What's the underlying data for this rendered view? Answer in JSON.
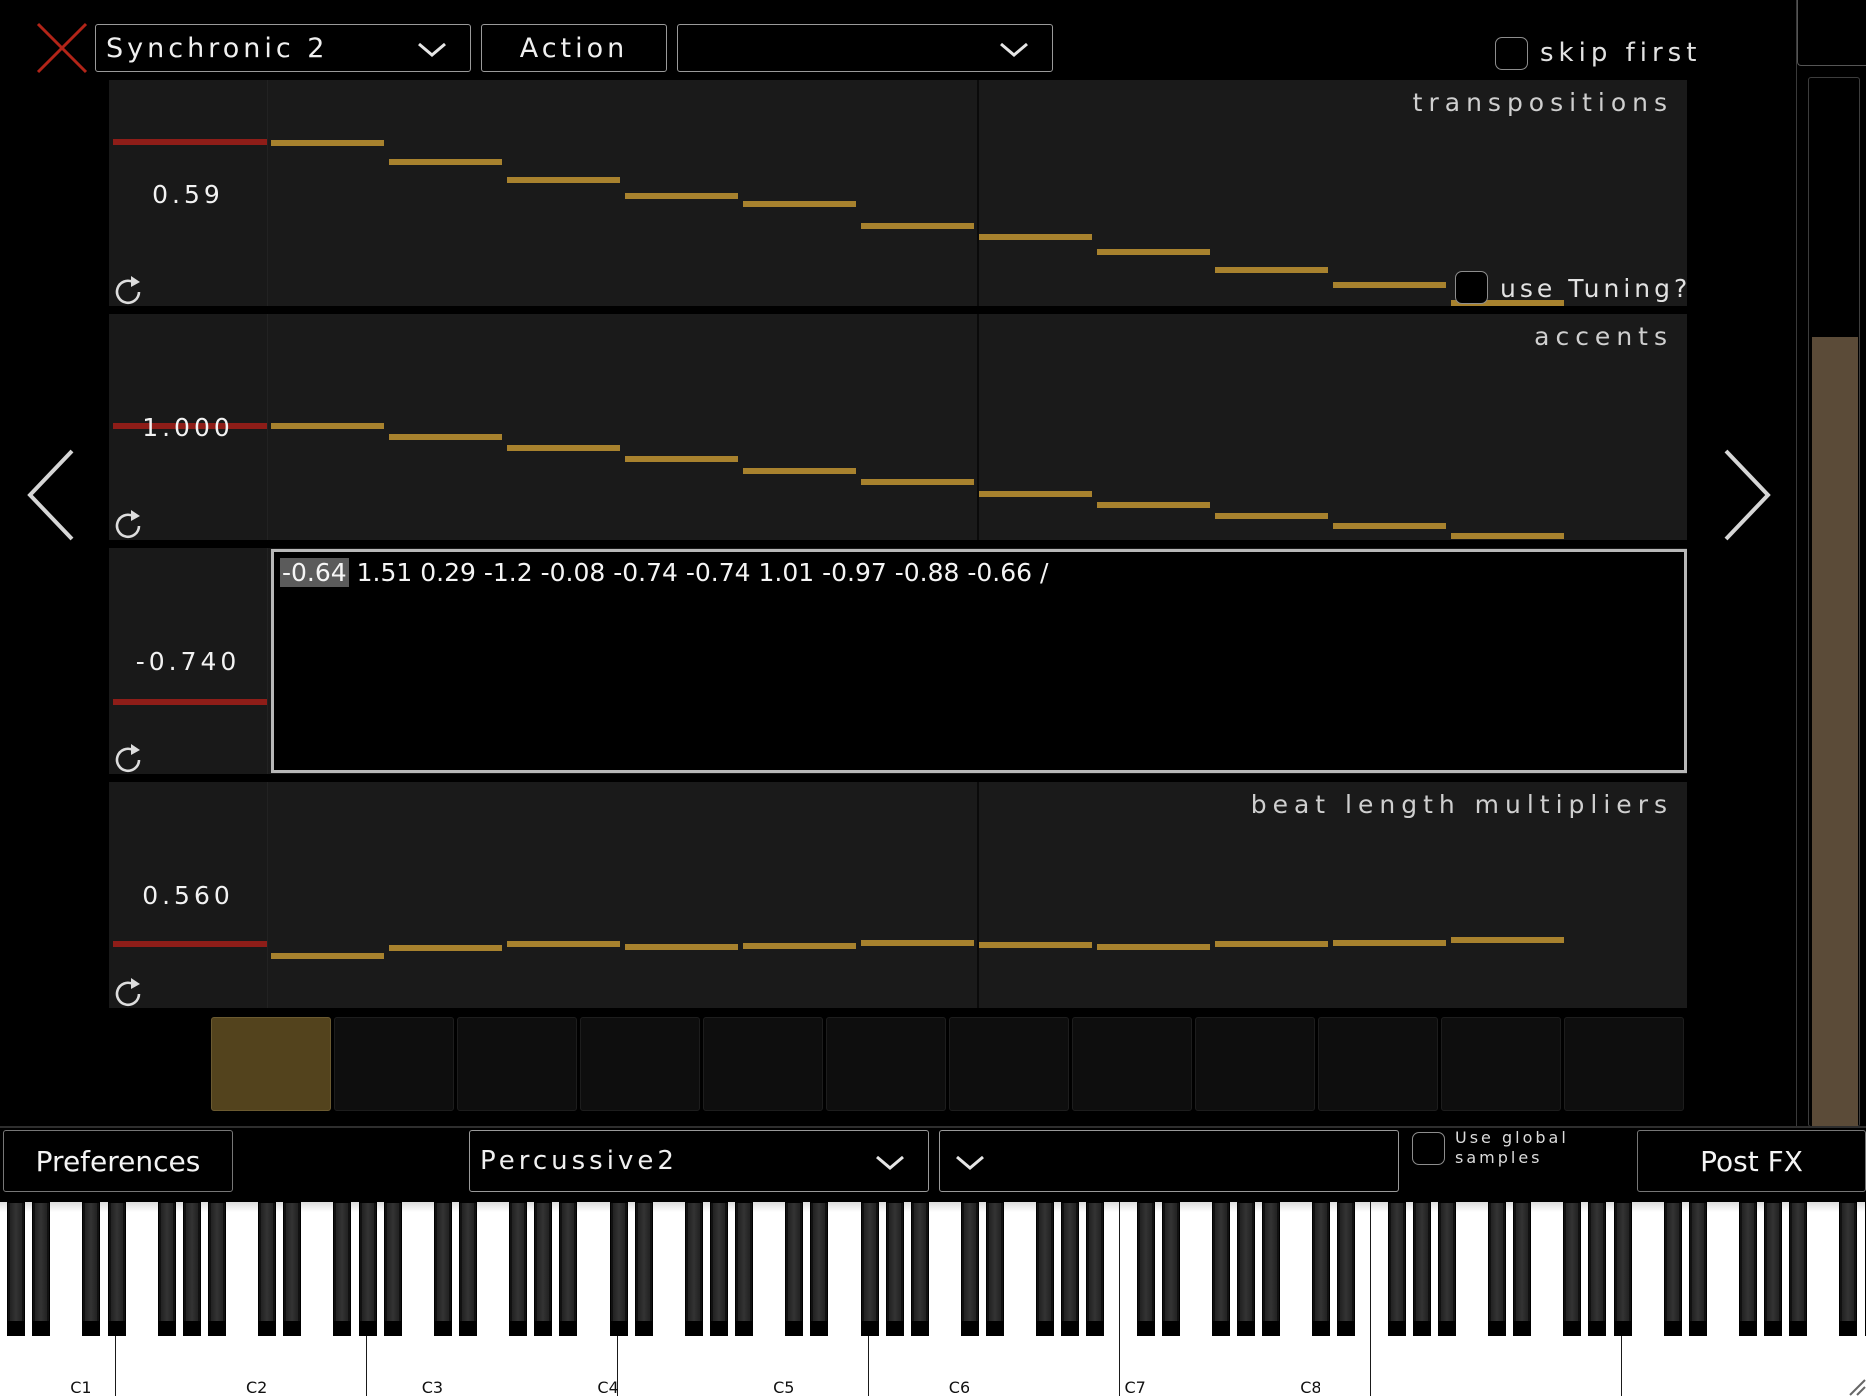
{
  "header": {
    "preparation_select": "Synchronic 2",
    "action_button": "Action",
    "second_select": "",
    "skip_first_label": "skip first"
  },
  "sliders": {
    "transpositions": {
      "title": "transpositions",
      "value": "0.59",
      "use_tuning_label": "use Tuning?"
    },
    "accents": {
      "title": "accents",
      "value": "1.000"
    },
    "sustain_lengths": {
      "value": "-0.740",
      "text_selected": "-0.64",
      "text_rest": " 1.51 0.29 -1.2 -0.08 -0.74 -0.74 1.01 -0.97 -0.88 -0.66 /"
    },
    "beat_length_multipliers": {
      "title": "beat length multipliers",
      "value": "0.560"
    }
  },
  "steps": {
    "count": 12,
    "active_index": 0
  },
  "vertical_scroll": {
    "fraction_visible": 0.75,
    "position": "bottom"
  },
  "footer": {
    "preferences_button": "Preferences",
    "sample_select": "Percussive2",
    "second_select": "",
    "use_global_samples_label_1": "Use global",
    "use_global_samples_label_2": "samples",
    "post_fx_button": "Post FX"
  },
  "piano": {
    "octave_labels": [
      "C1",
      "C2",
      "C3",
      "C4",
      "C5",
      "C6",
      "C7",
      "C8"
    ]
  },
  "colors": {
    "bar_gold": "#a8822e",
    "indicator_red": "#8e1d18",
    "close_red": "#b22418",
    "active_step": "#53431d",
    "scroll_thumb": "#5b4b38"
  }
}
